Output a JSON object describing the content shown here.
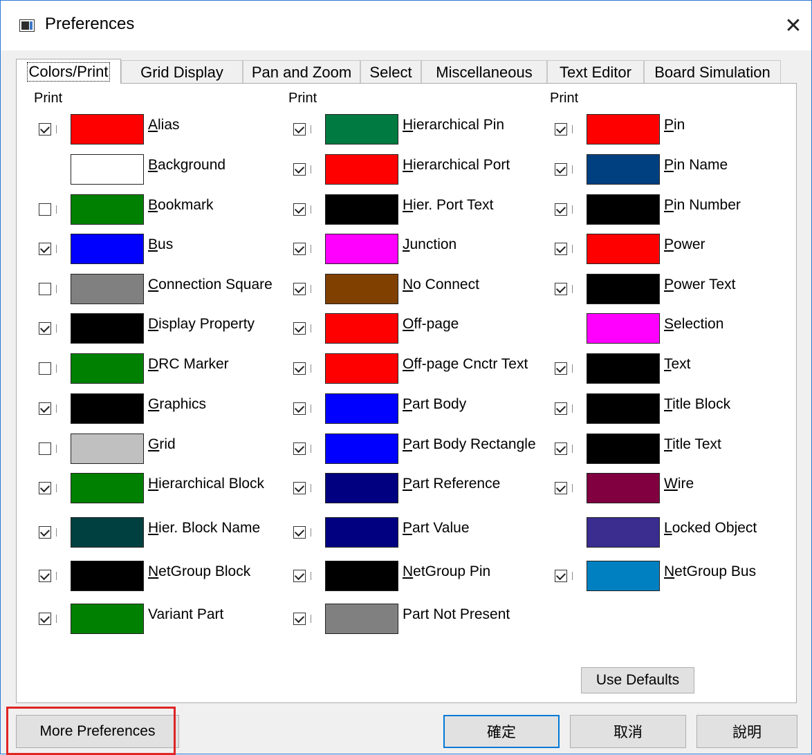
{
  "window": {
    "title": "Preferences"
  },
  "tabs": [
    {
      "label": "Colors/Print",
      "active": true
    },
    {
      "label": "Grid Display"
    },
    {
      "label": "Pan and Zoom"
    },
    {
      "label": "Select"
    },
    {
      "label": "Miscellaneous"
    },
    {
      "label": "Text Editor"
    },
    {
      "label": "Board Simulation"
    }
  ],
  "columns": [
    {
      "print_label": "Print",
      "items": [
        {
          "label": "Alias",
          "mnemonic_index": 0,
          "color": "#ff0000",
          "has_checkbox": true,
          "checked": true
        },
        {
          "label": "Background",
          "mnemonic_index": 0,
          "color": "#ffffff",
          "has_checkbox": false,
          "checked": false
        },
        {
          "label": "Bookmark",
          "mnemonic_index": 0,
          "color": "#008000",
          "has_checkbox": true,
          "checked": false
        },
        {
          "label": "Bus",
          "mnemonic_index": 0,
          "color": "#0000ff",
          "has_checkbox": true,
          "checked": true
        },
        {
          "label": "Connection Square",
          "mnemonic_index": 0,
          "color": "#808080",
          "has_checkbox": true,
          "checked": false
        },
        {
          "label": "Display Property",
          "mnemonic_index": 0,
          "color": "#000000",
          "has_checkbox": true,
          "checked": true
        },
        {
          "label": "DRC Marker",
          "mnemonic_index": 0,
          "color": "#008000",
          "has_checkbox": true,
          "checked": false
        },
        {
          "label": "Graphics",
          "mnemonic_index": 0,
          "color": "#000000",
          "has_checkbox": true,
          "checked": true
        },
        {
          "label": "Grid",
          "mnemonic_index": 0,
          "color": "#c0c0c0",
          "has_checkbox": true,
          "checked": false
        },
        {
          "label": "Hierarchical Block",
          "mnemonic_index": 0,
          "color": "#008000",
          "has_checkbox": true,
          "checked": true
        },
        {
          "label": "Hier. Block Name",
          "mnemonic_index": 0,
          "color": "#004040",
          "has_checkbox": true,
          "checked": true
        },
        {
          "label": "NetGroup Block",
          "mnemonic_index": 0,
          "color": "#000000",
          "has_checkbox": true,
          "checked": true
        },
        {
          "label": "Variant Part",
          "mnemonic_index": -1,
          "color": "#008000",
          "has_checkbox": true,
          "checked": true
        }
      ]
    },
    {
      "print_label": "Print",
      "items": [
        {
          "label": "Hierarchical Pin",
          "mnemonic_index": 0,
          "color": "#007a40",
          "has_checkbox": true,
          "checked": true
        },
        {
          "label": "Hierarchical Port",
          "mnemonic_index": 0,
          "color": "#ff0000",
          "has_checkbox": true,
          "checked": true
        },
        {
          "label": "Hier. Port Text",
          "mnemonic_index": 0,
          "color": "#000000",
          "has_checkbox": true,
          "checked": true
        },
        {
          "label": "Junction",
          "mnemonic_index": 0,
          "color": "#ff00ff",
          "has_checkbox": true,
          "checked": true
        },
        {
          "label": "No Connect",
          "mnemonic_index": 0,
          "color": "#804000",
          "has_checkbox": true,
          "checked": true
        },
        {
          "label": "Off-page",
          "mnemonic_index": 0,
          "color": "#ff0000",
          "has_checkbox": true,
          "checked": true
        },
        {
          "label": "Off-page Cnctr Text",
          "mnemonic_index": 0,
          "color": "#ff0000",
          "has_checkbox": true,
          "checked": true
        },
        {
          "label": "Part Body",
          "mnemonic_index": 0,
          "color": "#0000ff",
          "has_checkbox": true,
          "checked": true
        },
        {
          "label": "Part Body Rectangle",
          "mnemonic_index": 0,
          "color": "#0000ff",
          "has_checkbox": true,
          "checked": true
        },
        {
          "label": "Part Reference",
          "mnemonic_index": 0,
          "color": "#000080",
          "has_checkbox": true,
          "checked": true
        },
        {
          "label": "Part Value",
          "mnemonic_index": 0,
          "color": "#000080",
          "has_checkbox": true,
          "checked": true
        },
        {
          "label": "NetGroup Pin",
          "mnemonic_index": 0,
          "color": "#000000",
          "has_checkbox": true,
          "checked": true
        },
        {
          "label": "Part Not Present",
          "mnemonic_index": -1,
          "color": "#808080",
          "has_checkbox": true,
          "checked": true
        }
      ]
    },
    {
      "print_label": "Print",
      "items": [
        {
          "label": "Pin",
          "mnemonic_index": 0,
          "color": "#ff0000",
          "has_checkbox": true,
          "checked": true
        },
        {
          "label": "Pin Name",
          "mnemonic_index": 0,
          "color": "#004080",
          "has_checkbox": true,
          "checked": true
        },
        {
          "label": "Pin Number",
          "mnemonic_index": 0,
          "color": "#000000",
          "has_checkbox": true,
          "checked": true
        },
        {
          "label": "Power",
          "mnemonic_index": 0,
          "color": "#ff0000",
          "has_checkbox": true,
          "checked": true
        },
        {
          "label": "Power Text",
          "mnemonic_index": 0,
          "color": "#000000",
          "has_checkbox": true,
          "checked": true
        },
        {
          "label": "Selection",
          "mnemonic_index": 0,
          "color": "#ff00ff",
          "has_checkbox": false,
          "checked": false
        },
        {
          "label": "Text",
          "mnemonic_index": 0,
          "color": "#000000",
          "has_checkbox": true,
          "checked": true
        },
        {
          "label": "Title Block",
          "mnemonic_index": 0,
          "color": "#000000",
          "has_checkbox": true,
          "checked": true
        },
        {
          "label": "Title Text",
          "mnemonic_index": 0,
          "color": "#000000",
          "has_checkbox": true,
          "checked": true
        },
        {
          "label": "Wire",
          "mnemonic_index": 0,
          "color": "#800040",
          "has_checkbox": true,
          "checked": true
        },
        {
          "label": "Locked Object",
          "mnemonic_index": 0,
          "color": "#3a2d8f",
          "has_checkbox": false,
          "checked": false
        },
        {
          "label": "NetGroup Bus",
          "mnemonic_index": 0,
          "color": "#0080c0",
          "has_checkbox": true,
          "checked": true
        }
      ]
    }
  ],
  "buttons": {
    "use_defaults": "Use Defaults",
    "more_preferences": "More Preferences",
    "ok": "確定",
    "cancel": "取消",
    "help": "說明"
  },
  "colors": {
    "highlight": "#e02424",
    "accent": "#0078d7"
  }
}
